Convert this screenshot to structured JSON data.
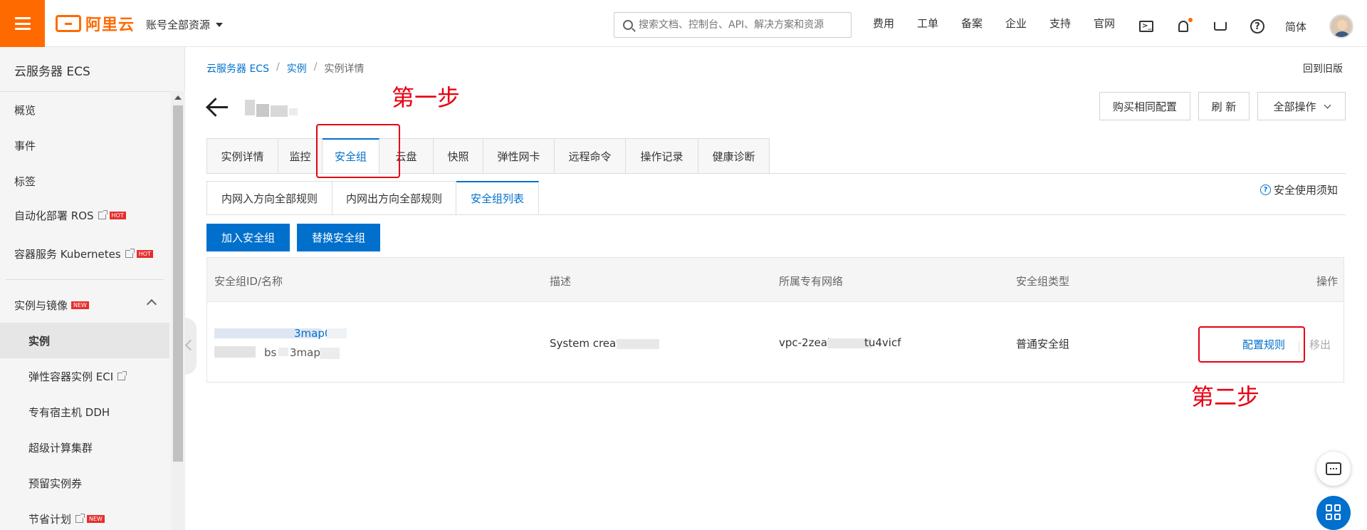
{
  "topbar": {
    "logo_text": "阿里云",
    "account_label": "账号全部资源",
    "search_placeholder": "搜索文档、控制台、API、解决方案和资源",
    "nav": [
      "费用",
      "工单",
      "备案",
      "企业",
      "支持",
      "官网"
    ],
    "lang": "简体",
    "terminal_glyph": ">_",
    "help_glyph": "?"
  },
  "sidebar": {
    "title": "云服务器 ECS",
    "items": [
      {
        "label": "概览"
      },
      {
        "label": "事件"
      },
      {
        "label": "标签"
      },
      {
        "label": "自动化部署 ROS",
        "badge": "HOT"
      },
      {
        "label": "容器服务 Kubernetes",
        "badge": "HOT"
      }
    ],
    "group": {
      "label": "实例与镜像",
      "badge": "NEW"
    },
    "sub_items": [
      {
        "label": "实例"
      },
      {
        "label": "弹性容器实例 ECI"
      },
      {
        "label": "专有宿主机 DDH"
      },
      {
        "label": "超级计算集群"
      },
      {
        "label": "预留实例券"
      },
      {
        "label": "节省计划",
        "badge": "NEW"
      }
    ]
  },
  "breadcrumb": {
    "items": [
      "云服务器 ECS",
      "实例",
      "实例详情"
    ],
    "separator": "/"
  },
  "old_version_link": "回到旧版",
  "header_buttons": {
    "buy_same": "购买相同配置",
    "refresh": "刷 新",
    "all_ops": "全部操作"
  },
  "tabs": [
    "实例详情",
    "监控",
    "安全组",
    "云盘",
    "快照",
    "弹性网卡",
    "远程命令",
    "操作记录",
    "健康诊断"
  ],
  "active_tab": "安全组",
  "sub_tabs": [
    "内网入方向全部规则",
    "内网出方向全部规则",
    "安全组列表"
  ],
  "active_sub_tab": "安全组列表",
  "notice_link": "安全使用须知",
  "notice_glyph": "?",
  "actions": {
    "join": "加入安全组",
    "replace": "替换安全组"
  },
  "table": {
    "columns": [
      "安全组ID/名称",
      "描述",
      "所属专有网络",
      "安全组类型",
      "操作"
    ],
    "row": {
      "id_fragment": "3map0",
      "name_fragment_a": "bs",
      "name_fragment_b": "3map",
      "description": "System createc",
      "vpc_prefix": "vpc-2zeai",
      "vpc_suffix": "tu4vicf",
      "type": "普通安全组",
      "op_configure": "配置规则",
      "op_remove": "移出"
    }
  },
  "annotations": {
    "step1": "第一步",
    "step2": "第二步"
  },
  "colors": {
    "brand": "#ff6a00",
    "link": "#0070cc",
    "annotation": "#e60012",
    "hot_badge": "#e62e2e"
  }
}
